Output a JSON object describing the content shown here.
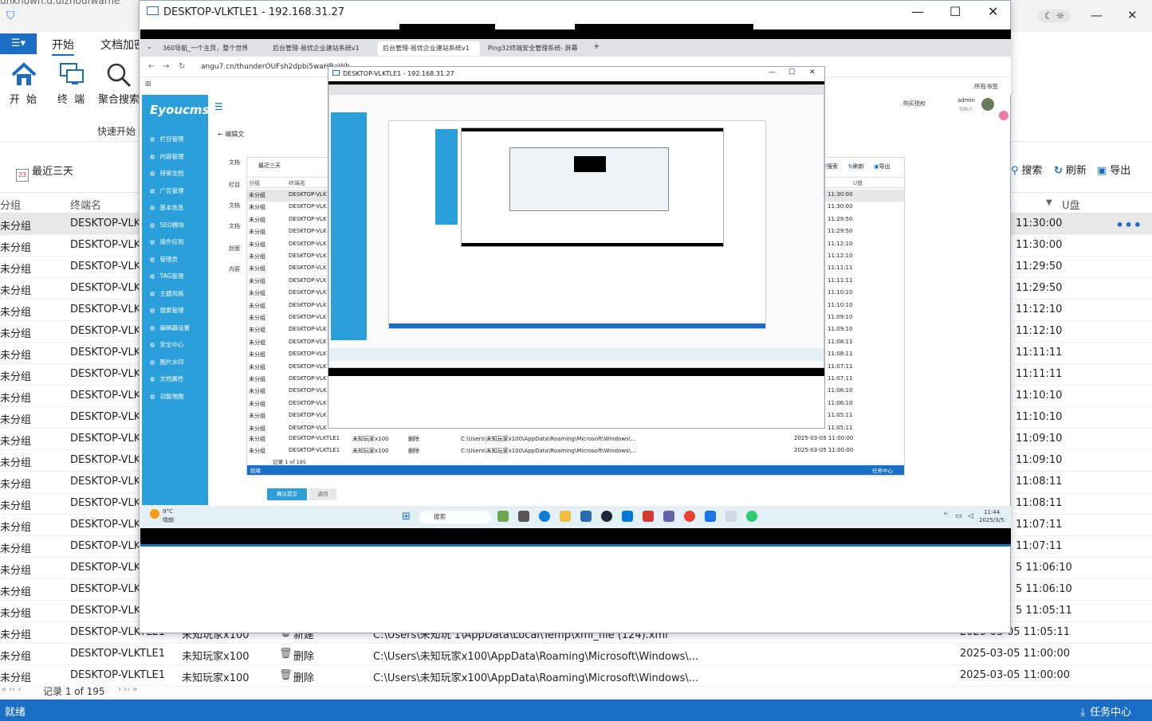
{
  "bg_app": {
    "title_fragment": "unknown.d.ulzhoufwarne",
    "window_controls": {
      "minimize": "—",
      "close": "✕"
    },
    "menu_label": "☰▾",
    "ribbon_tabs": [
      "开始",
      "文档加密"
    ],
    "ribbon_buttons": [
      {
        "label": "开 始",
        "icon": "home-icon"
      },
      {
        "label": "终 端",
        "icon": "computer-icon"
      },
      {
        "label": "聚合搜索",
        "icon": "search-icon"
      }
    ],
    "ribbon_group": "快速开始",
    "date_filter": "最近三天",
    "toolbar_right": [
      {
        "label": "搜索",
        "icon": "search-icon"
      },
      {
        "label": "刷新",
        "icon": "refresh-icon"
      },
      {
        "label": "导出",
        "icon": "save-icon"
      }
    ],
    "columns": [
      "分组",
      "终端名",
      "U盘"
    ],
    "rows": [
      {
        "group": "未分组",
        "terminal": "DESKTOP-VLKT",
        "time": "11:30:00"
      },
      {
        "group": "未分组",
        "terminal": "DESKTOP-VLKT",
        "time": "11:30:00"
      },
      {
        "group": "未分组",
        "terminal": "DESKTOP-VLKT",
        "time": "11:29:50"
      },
      {
        "group": "未分组",
        "terminal": "DESKTOP-VLKT",
        "time": "11:29:50"
      },
      {
        "group": "未分组",
        "terminal": "DESKTOP-VLKT",
        "time": "11:12:10"
      },
      {
        "group": "未分组",
        "terminal": "DESKTOP-VLKT",
        "time": "11:12:10"
      },
      {
        "group": "未分组",
        "terminal": "DESKTOP-VLKT",
        "time": "11:11:11"
      },
      {
        "group": "未分组",
        "terminal": "DESKTOP-VLKT",
        "time": "11:11:11"
      },
      {
        "group": "未分组",
        "terminal": "DESKTOP-VLKT",
        "time": "11:10:10"
      },
      {
        "group": "未分组",
        "terminal": "DESKTOP-VLKT",
        "time": "11:10:10"
      },
      {
        "group": "未分组",
        "terminal": "DESKTOP-VLKT",
        "time": "11:09:10"
      },
      {
        "group": "未分组",
        "terminal": "DESKTOP-VLKT",
        "time": "11:09:10"
      },
      {
        "group": "未分组",
        "terminal": "DESKTOP-VLKT",
        "time": "11:08:11"
      },
      {
        "group": "未分组",
        "terminal": "DESKTOP-VLKT",
        "time": "11:08:11"
      },
      {
        "group": "未分组",
        "terminal": "DESKTOP-VLKT",
        "time": "11:07:11"
      },
      {
        "group": "未分组",
        "terminal": "DESKTOP-VLKT",
        "time": "11:07:11"
      },
      {
        "group": "未分组",
        "terminal": "DESKTOP-VLKT",
        "time": "5 11:06:10"
      },
      {
        "group": "未分组",
        "terminal": "DESKTOP-VLKT",
        "time": "5 11:06:10"
      },
      {
        "group": "未分组",
        "terminal": "DESKTOP-VLKT",
        "time": "5 11:05:11"
      }
    ],
    "bottom_rows": [
      {
        "group": "未分组",
        "terminal": "DESKTOP-VLKTLE1",
        "user": "未知玩家x100",
        "action": "新建",
        "path": "C:\\Users\\未知玩 1\\AppData\\Local\\Temp\\xml_file (124).xml",
        "time": "2025-03-05 11:05:11"
      },
      {
        "group": "未分组",
        "terminal": "DESKTOP-VLKTLE1",
        "user": "未知玩家x100",
        "action": "删除",
        "path": "C:\\Users\\未知玩家x100\\AppData\\Roaming\\Microsoft\\Windows\\...",
        "time": "2025-03-05 11:00:00"
      },
      {
        "group": "未分组",
        "terminal": "DESKTOP-VLKTLE1",
        "user": "未知玩家x100",
        "action": "删除",
        "path": "C:\\Users\\未知玩家x100\\AppData\\Roaming\\Microsoft\\Windows\\...",
        "time": "2025-03-05 11:00:00"
      }
    ],
    "pager": {
      "nav_left": "« ‹‹ ‹",
      "text": "记录 1 of 195",
      "nav_right": "› ›› »"
    },
    "status_left": "就绪",
    "status_right": "任务中心"
  },
  "remote1": {
    "title": "DESKTOP-VLKTLE1 - 192.168.31.27",
    "controls": {
      "minimize": "—",
      "maximize": "☐",
      "close": "✕"
    },
    "browser": {
      "tabs": [
        {
          "label": "360导航_一个主页，整个世界",
          "active": false
        },
        {
          "label": "后台管理-易优企业建站系统v1",
          "active": false
        },
        {
          "label": "后台管理-易优企业建站系统v1",
          "active": true
        },
        {
          "label": "Ping32终端安全管理系统- 屏幕",
          "active": false
        }
      ],
      "new_tab": "+",
      "url": "angu7.cn/thunderOUFsh2dpbi5waHBaWh",
      "bookmarks": "所有书签"
    },
    "cms": {
      "logo": "Eyoucms",
      "menu": [
        "栏目管理",
        "内容管理",
        "待审文档",
        "广告管理",
        "基本信息",
        "SEO模块",
        "插件应用",
        "管理员",
        "TAG管理",
        "主题风格",
        "搜索管理",
        "编辑器设置",
        "安全中心",
        "图片水印",
        "文档属性",
        "功能地图"
      ],
      "back_label": "编辑文",
      "left_labels": [
        "文档",
        "栏目",
        "文档",
        "文档",
        "封面",
        "内容"
      ],
      "buy": "购买授权",
      "admin": "admin",
      "admin_role": "创始人",
      "submit": "确认提交",
      "back": "返回"
    },
    "nested_app": {
      "date_filter": "最近三天",
      "tools": [
        "搜索",
        "刷新",
        "导出"
      ],
      "columns": [
        "分组",
        "终端名",
        "U盘"
      ],
      "rows": [
        {
          "group": "未分组",
          "terminal": "DESKTOP-VLK",
          "time": "11:30:00"
        },
        {
          "group": "未分组",
          "terminal": "DESKTOP-VLK",
          "time": "11:30:00"
        },
        {
          "group": "未分组",
          "terminal": "DESKTOP-VLK",
          "time": "11:29:50"
        },
        {
          "group": "未分组",
          "terminal": "DESKTOP-VLK",
          "time": "11:29:50"
        },
        {
          "group": "未分组",
          "terminal": "DESKTOP-VLK",
          "time": "11:12:10"
        },
        {
          "group": "未分组",
          "terminal": "DESKTOP-VLK",
          "time": "11:12:10"
        },
        {
          "group": "未分组",
          "terminal": "DESKTOP-VLK",
          "time": "11:11:11"
        },
        {
          "group": "未分组",
          "terminal": "DESKTOP-VLK",
          "time": "11:11:11"
        },
        {
          "group": "未分组",
          "terminal": "DESKTOP-VLK",
          "time": "11:10:10"
        },
        {
          "group": "未分组",
          "terminal": "DESKTOP-VLK",
          "time": "11:10:10"
        },
        {
          "group": "未分组",
          "terminal": "DESKTOP-VLK",
          "time": "11:09:10"
        },
        {
          "group": "未分组",
          "terminal": "DESKTOP-VLK",
          "time": "11:09:10"
        },
        {
          "group": "未分组",
          "terminal": "DESKTOP-VLK",
          "time": "11:08:11"
        },
        {
          "group": "未分组",
          "terminal": "DESKTOP-VLK",
          "time": "11:08:11"
        },
        {
          "group": "未分组",
          "terminal": "DESKTOP-VLK",
          "time": "11:07:11"
        },
        {
          "group": "未分组",
          "terminal": "DESKTOP-VLK",
          "time": "11:07:11"
        },
        {
          "group": "未分组",
          "terminal": "DESKTOP-VLK",
          "time": "11:06:10"
        },
        {
          "group": "未分组",
          "terminal": "DESKTOP-VLK",
          "time": "11:06:10"
        },
        {
          "group": "未分组",
          "terminal": "DESKTOP-VLK",
          "time": "11:05:11"
        },
        {
          "group": "未分组",
          "terminal": "DESKTOP-VLK",
          "time": "11:05:11"
        }
      ],
      "bottom_rows": [
        {
          "group": "未分组",
          "terminal": "DESKTOP-VLKTLE1",
          "user": "未知玩家x100",
          "action": "删除",
          "path": "C:\\Users\\未知玩家x100\\AppData\\Roaming\\Microsoft\\Windows\\...",
          "time": "2025-03-05 11:00:00"
        },
        {
          "group": "未分组",
          "terminal": "DESKTOP-VLKTLE1",
          "user": "未知玩家x100",
          "action": "删除",
          "path": "C:\\Users\\未知玩家x100\\AppData\\Roaming\\Microsoft\\Windows\\...",
          "time": "2025-03-05 11:00:00"
        }
      ],
      "pager": "记录 1 of 195",
      "status_left": "就绪",
      "status_right": "任务中心"
    },
    "taskbar": {
      "weather_temp": "9°C",
      "weather_text": "晴朗",
      "search": "搜索",
      "time": "11:44",
      "date": "2025/3/5"
    }
  },
  "remote2": {
    "title": "DESKTOP-VLKTLE1 - 192.168.31.27",
    "controls": {
      "minimize": "—",
      "maximize": "☐",
      "close": "✕"
    }
  },
  "colors": {
    "accent": "#1a6fc4",
    "cms_sidebar": "#2b9fd9",
    "status_bar": "#1a6fc4"
  }
}
